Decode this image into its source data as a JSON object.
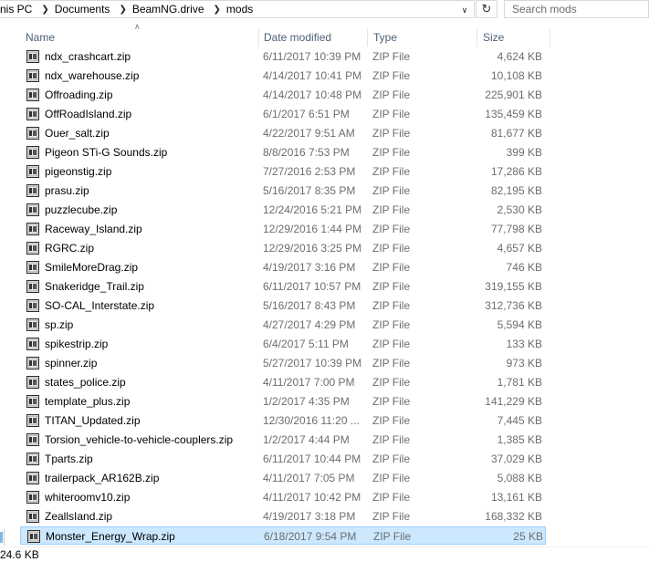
{
  "breadcrumbs": [
    "nis PC",
    "BeamNG.drive",
    "mods"
  ],
  "breadcrumb_documents": "Documents",
  "search": {
    "placeholder": "Search mods"
  },
  "columns": {
    "name": "Name",
    "date": "Date modified",
    "type": "Type",
    "size": "Size"
  },
  "status": {
    "size_text": "24.6 KB"
  },
  "colors": {
    "selected_bg": "#cce8ff",
    "selected_border": "#99d1ff",
    "header_text": "#4c607a"
  },
  "files": [
    {
      "name": "ndx_crashcart.zip",
      "date": "6/11/2017 10:39 PM",
      "type": "ZIP File",
      "size": "4,624 KB"
    },
    {
      "name": "ndx_warehouse.zip",
      "date": "4/14/2017 10:41 PM",
      "type": "ZIP File",
      "size": "10,108 KB"
    },
    {
      "name": "Offroading.zip",
      "date": "4/14/2017 10:48 PM",
      "type": "ZIP File",
      "size": "225,901 KB"
    },
    {
      "name": "OffRoadIsland.zip",
      "date": "6/1/2017 6:51 PM",
      "type": "ZIP File",
      "size": "135,459 KB"
    },
    {
      "name": "Ouer_salt.zip",
      "date": "4/22/2017 9:51 AM",
      "type": "ZIP File",
      "size": "81,677 KB"
    },
    {
      "name": "Pigeon STi-G Sounds.zip",
      "date": "8/8/2016 7:53 PM",
      "type": "ZIP File",
      "size": "399 KB"
    },
    {
      "name": "pigeonstig.zip",
      "date": "7/27/2016 2:53 PM",
      "type": "ZIP File",
      "size": "17,286 KB"
    },
    {
      "name": "prasu.zip",
      "date": "5/16/2017 8:35 PM",
      "type": "ZIP File",
      "size": "82,195 KB"
    },
    {
      "name": "puzzlecube.zip",
      "date": "12/24/2016 5:21 PM",
      "type": "ZIP File",
      "size": "2,530 KB"
    },
    {
      "name": "Raceway_Island.zip",
      "date": "12/29/2016 1:44 PM",
      "type": "ZIP File",
      "size": "77,798 KB"
    },
    {
      "name": "RGRC.zip",
      "date": "12/29/2016 3:25 PM",
      "type": "ZIP File",
      "size": "4,657 KB"
    },
    {
      "name": "SmileMoreDrag.zip",
      "date": "4/19/2017 3:16 PM",
      "type": "ZIP File",
      "size": "746 KB"
    },
    {
      "name": "Snakeridge_Trail.zip",
      "date": "6/11/2017 10:57 PM",
      "type": "ZIP File",
      "size": "319,155 KB"
    },
    {
      "name": "SO-CAL_Interstate.zip",
      "date": "5/16/2017 8:43 PM",
      "type": "ZIP File",
      "size": "312,736 KB"
    },
    {
      "name": "sp.zip",
      "date": "4/27/2017 4:29 PM",
      "type": "ZIP File",
      "size": "5,594 KB"
    },
    {
      "name": "spikestrip.zip",
      "date": "6/4/2017 5:11 PM",
      "type": "ZIP File",
      "size": "133 KB"
    },
    {
      "name": "spinner.zip",
      "date": "5/27/2017 10:39 PM",
      "type": "ZIP File",
      "size": "973 KB"
    },
    {
      "name": "states_police.zip",
      "date": "4/11/2017 7:00 PM",
      "type": "ZIP File",
      "size": "1,781 KB"
    },
    {
      "name": "template_plus.zip",
      "date": "1/2/2017 4:35 PM",
      "type": "ZIP File",
      "size": "141,229 KB"
    },
    {
      "name": "TITAN_Updated.zip",
      "date": "12/30/2016 11:20 ...",
      "type": "ZIP File",
      "size": "7,445 KB"
    },
    {
      "name": "Torsion_vehicle-to-vehicle-couplers.zip",
      "date": "1/2/2017 4:44 PM",
      "type": "ZIP File",
      "size": "1,385 KB"
    },
    {
      "name": "Tparts.zip",
      "date": "6/11/2017 10:44 PM",
      "type": "ZIP File",
      "size": "37,029 KB"
    },
    {
      "name": "trailerpack_AR162B.zip",
      "date": "4/11/2017 7:05 PM",
      "type": "ZIP File",
      "size": "5,088 KB"
    },
    {
      "name": "whiteroomv10.zip",
      "date": "4/11/2017 10:42 PM",
      "type": "ZIP File",
      "size": "13,161 KB"
    },
    {
      "name": "ZeallsIand.zip",
      "date": "4/19/2017 3:18 PM",
      "type": "ZIP File",
      "size": "168,332 KB"
    },
    {
      "name": "Monster_Energy_Wrap.zip",
      "date": "6/18/2017 9:54 PM",
      "type": "ZIP File",
      "size": "25 KB",
      "selected": true
    }
  ]
}
